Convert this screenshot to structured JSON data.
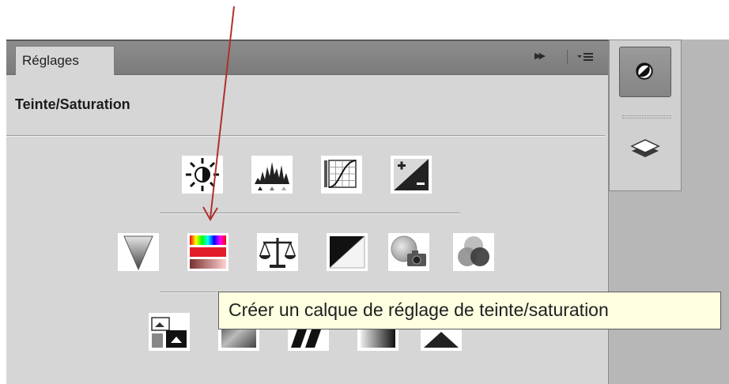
{
  "panel": {
    "tab_label": "Réglages",
    "title": "Teinte/Saturation",
    "collapse_glyph": "▶▶",
    "menu_icon": "panel-menu-icon"
  },
  "icons": {
    "row1": [
      "brightness-contrast-icon",
      "levels-icon",
      "curves-icon",
      "exposure-icon"
    ],
    "row2": [
      "vibrance-icon",
      "hue-saturation-icon",
      "color-balance-icon",
      "black-white-icon",
      "photo-filter-icon",
      "channel-mixer-icon"
    ],
    "row3": [
      "invert-icon",
      "posterize-icon",
      "threshold-icon",
      "gradient-map-icon",
      "selective-color-icon"
    ]
  },
  "tooltip": {
    "text": "Créer un calque de réglage de teinte/saturation"
  },
  "dock": {
    "items": [
      "adjustments-dock-icon",
      "layers-dock-icon"
    ]
  },
  "colors": {
    "annotation_arrow": "#b03030",
    "panel_bg": "#d6d6d6",
    "tooltip_bg": "#ffffe1"
  }
}
